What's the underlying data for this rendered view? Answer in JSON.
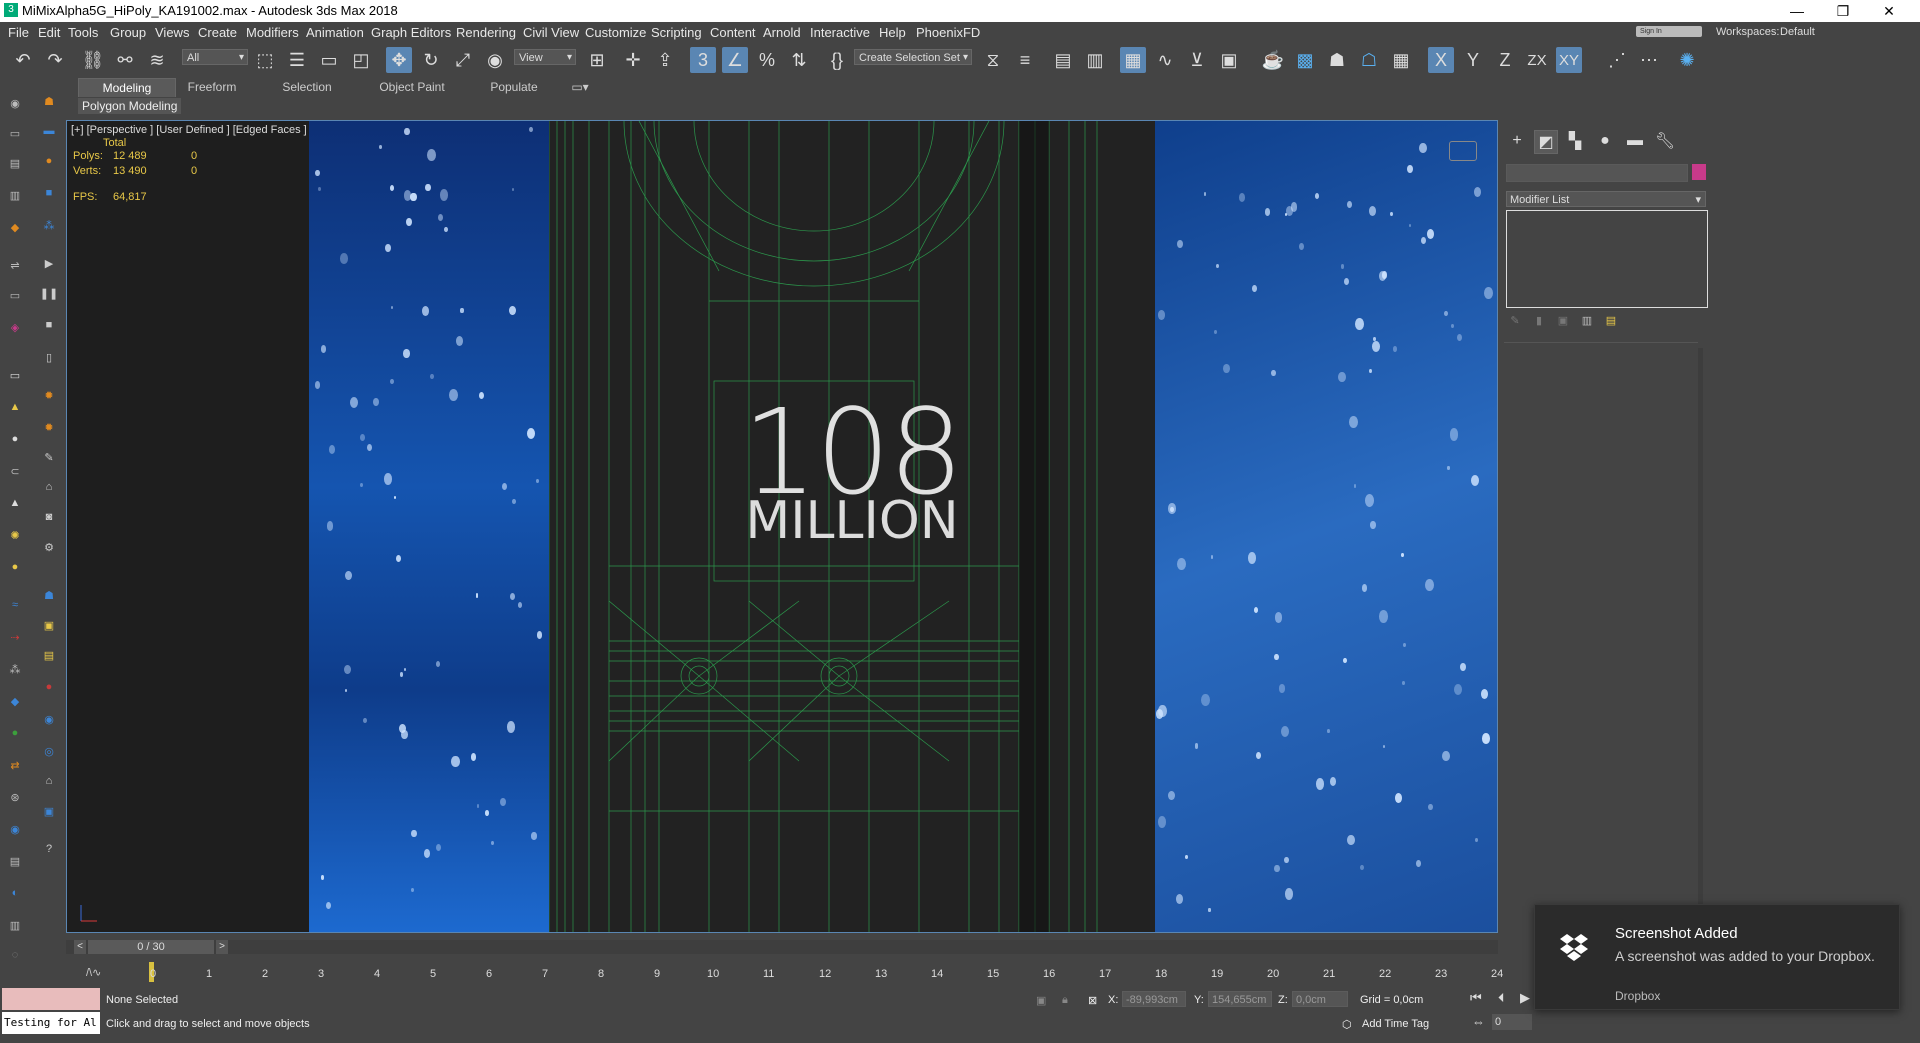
{
  "window": {
    "title": "MiMixAlpha5G_HiPoly_KA191002.max - Autodesk 3ds Max 2018",
    "app_icon": "3",
    "minimize": "—",
    "maximize": "❐",
    "close": "✕"
  },
  "menubar": {
    "items": [
      "File",
      "Edit",
      "Tools",
      "Group",
      "Views",
      "Create",
      "Modifiers",
      "Animation",
      "Graph Editors",
      "Rendering",
      "Civil View",
      "Customize",
      "Scripting",
      "Content",
      "Arnold",
      "Interactive",
      "Help",
      "PhoenixFD"
    ],
    "sign_in": "Sign In",
    "workspaces_label": "Workspaces:",
    "workspaces_value": "Default"
  },
  "toolbar": {
    "selection_filter": "All",
    "reference_coord": "View",
    "named_selection": "Create Selection Set",
    "axis_x": "X",
    "axis_y": "Y",
    "axis_z": "Z",
    "axis_zx": "ZX",
    "axis_xy": "XY"
  },
  "ribbon": {
    "tabs": [
      "Modeling",
      "Freeform",
      "Selection",
      "Object Paint",
      "Populate"
    ],
    "active_tab": "Modeling",
    "panel_label": "Polygon Modeling"
  },
  "viewport": {
    "label": "[+] [Perspective ] [User Defined ] [Edged Faces ]",
    "stats_header": "Total",
    "polys_label": "Polys:",
    "polys_total": "12 489",
    "polys_sel": "0",
    "verts_label": "Verts:",
    "verts_total": "13 490",
    "verts_sel": "0",
    "fps_label": "FPS:",
    "fps_value": "64,817",
    "big_number": "108",
    "big_word": "MILLION",
    "wireframe_color": "#2fbf5a",
    "water_color": "#1e5fb8"
  },
  "command_panel": {
    "modifier_list": "Modifier List",
    "object_color": "#c83a8a"
  },
  "timeslider": {
    "position": "0 / 30",
    "prev": "<",
    "next": ">",
    "ticks": [
      "0",
      "1",
      "2",
      "3",
      "4",
      "5",
      "6",
      "7",
      "8",
      "9",
      "10",
      "11",
      "12",
      "13",
      "14",
      "15",
      "16",
      "17",
      "18",
      "19",
      "20",
      "21",
      "22",
      "23",
      "24"
    ]
  },
  "statusbar": {
    "maxscript_text": "Testing for Al",
    "selection": "None Selected",
    "prompt": "Click and drag to select and move objects",
    "x_label": "X:",
    "x_value": "-89,993cm",
    "y_label": "Y:",
    "y_value": "154,655cm",
    "z_label": "Z:",
    "z_value": "0,0cm",
    "grid": "Grid = 0,0cm",
    "add_time_tag": "Add Time Tag",
    "frame": "0"
  },
  "toast": {
    "title": "Screenshot Added",
    "body": "A screenshot was added to your Dropbox.",
    "app": "Dropbox"
  }
}
